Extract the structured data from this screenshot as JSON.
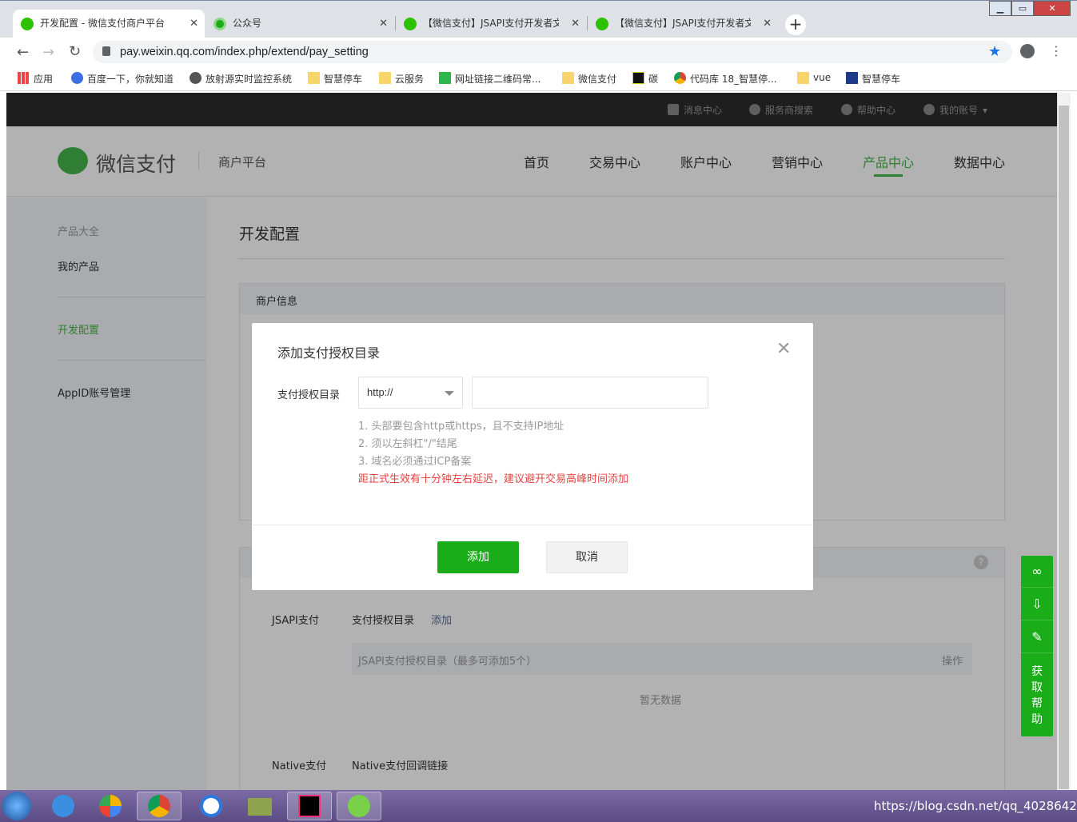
{
  "browser": {
    "tabs": [
      {
        "title": "开发配置 - 微信支付商户平台",
        "icon_color": "#2dc100",
        "active": true
      },
      {
        "title": "公众号",
        "icon_color": "#1aad19",
        "active": false
      },
      {
        "title": "【微信支付】JSAPI支付开发者文",
        "icon_color": "#2dc100",
        "active": false
      },
      {
        "title": "【微信支付】JSAPI支付开发者文",
        "icon_color": "#2dc100",
        "active": false
      }
    ],
    "tab_close": "✕",
    "new_tab": "+",
    "window_controls": {
      "min": "▁",
      "max": "▭",
      "close": "✕"
    },
    "url": "pay.weixin.qq.com/index.php/extend/pay_setting",
    "bookmarks": [
      {
        "label": "应用",
        "icon": "apps-grid-icon"
      },
      {
        "label": "百度一下，你就知道",
        "icon": "baidu-paw-icon"
      },
      {
        "label": "放射源实时监控系统",
        "icon": "globe-icon"
      },
      {
        "label": "智慧停车",
        "icon": "folder-icon"
      },
      {
        "label": "云服务",
        "icon": "folder-icon"
      },
      {
        "label": "网址链接二维码常...",
        "icon": "qr-icon"
      },
      {
        "label": "微信支付",
        "icon": "folder-icon"
      },
      {
        "label": "碳",
        "icon": "c-logo-icon"
      },
      {
        "label": "代码库 18_智慧停...",
        "icon": "chrome-icon"
      },
      {
        "label": "vue",
        "icon": "folder-icon"
      },
      {
        "label": "智慧停车",
        "icon": "blue-square-icon"
      }
    ]
  },
  "topbar": {
    "items": [
      "消息中心",
      "服务商搜索",
      "帮助中心",
      "我的账号"
    ]
  },
  "header": {
    "brand": "微信支付",
    "subtitle": "商户平台",
    "nav": [
      "首页",
      "交易中心",
      "账户中心",
      "营销中心",
      "产品中心",
      "数据中心"
    ],
    "selected": "产品中心",
    "accent": "#44b549"
  },
  "sidebar": {
    "items": [
      "产品大全",
      "我的产品",
      "开发配置",
      "AppID账号管理"
    ]
  },
  "content": {
    "title": "开发配置",
    "merchant_section": "商户信息",
    "jsapi_label": "JSAPI支付",
    "jsapi_dir_label": "支付授权目录",
    "jsapi_add_link": "添加",
    "table_header": "JSAPI支付授权目录（最多可添加5个）",
    "table_action": "操作",
    "empty": "暂无数据",
    "native_label": "Native支付",
    "native_callback": "Native支付回调链接"
  },
  "modal": {
    "title": "添加支付授权目录",
    "close": "✕",
    "field_label": "支付授权目录",
    "protocol": "http://",
    "path_value": "",
    "hints": [
      "1. 头部要包含http或https，且不支持IP地址",
      "2. 须以左斜杠\"/\"结尾",
      "3. 域名必须通过ICP备案"
    ],
    "warning": "距正式生效有十分钟左右延迟，建议避开交易高峰时间添加",
    "warning_color": "#e64340",
    "confirm": "添加",
    "cancel": "取消"
  },
  "helpbar": {
    "text": "获取帮助",
    "color": "#1aad19"
  },
  "watermark": "https://blog.csdn.net/qq_40286424"
}
